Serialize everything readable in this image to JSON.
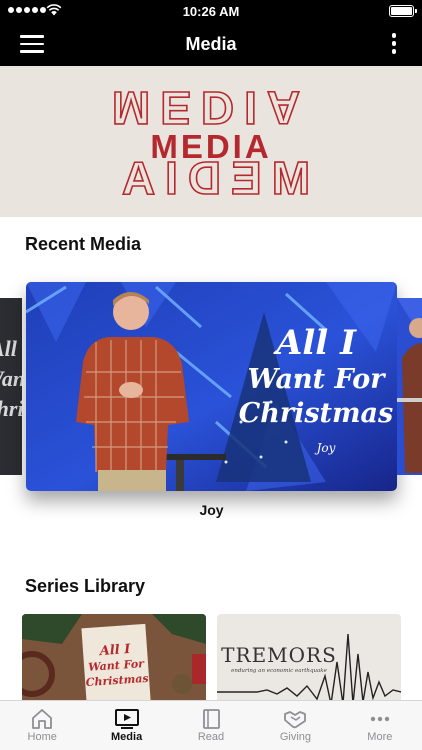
{
  "status_bar": {
    "time": "10:26 AM"
  },
  "header": {
    "title": "Media"
  },
  "hero": {
    "text": "MEDIA",
    "echo_text": "MEDIA"
  },
  "recent": {
    "title": "Recent Media",
    "featured": {
      "caption": "Joy",
      "artwork_text": [
        "All I",
        "Want For",
        "Christmas"
      ],
      "artwork_subtitle": "Joy"
    },
    "side_left_text": [
      "All",
      "Wan",
      "Chri"
    ]
  },
  "series": {
    "title": "Series Library",
    "items": [
      {
        "artwork_text": [
          "All I",
          "Want For",
          "Christmas"
        ]
      },
      {
        "artwork_title": "TREMORS",
        "artwork_subtitle": "enduring an economic earthquake"
      }
    ]
  },
  "tabs": [
    {
      "label": "Home",
      "icon": "home-icon",
      "active": false
    },
    {
      "label": "Media",
      "icon": "tv-play-icon",
      "active": true
    },
    {
      "label": "Read",
      "icon": "book-icon",
      "active": false
    },
    {
      "label": "Giving",
      "icon": "handshake-icon",
      "active": false
    },
    {
      "label": "More",
      "icon": "more-dots-icon",
      "active": false
    }
  ],
  "colors": {
    "accent": "#b5292e",
    "bar": "#000000",
    "tab_inactive": "#8e8e93"
  }
}
